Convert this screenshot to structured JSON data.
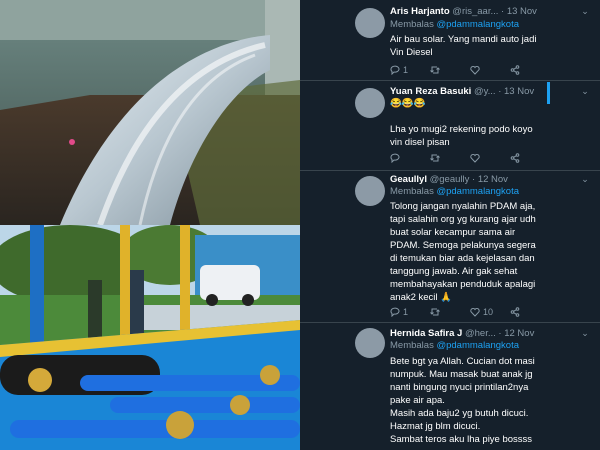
{
  "tweets": [
    {
      "name": "Aris Harjanto",
      "handle": "@ris_aar...",
      "date": "13 Nov",
      "reply_prefix": "Membalas",
      "reply_to": "@pdammalangkota",
      "lines": [
        "Air bau solar. Yang mandi auto jadi",
        "Vin Diesel"
      ],
      "counts": {
        "reply": "1",
        "retweet": "",
        "like": ""
      }
    },
    {
      "name": "Yuan Reza Basuki",
      "handle": "@y...",
      "date": "13 Nov",
      "lines": [
        "😂😂😂",
        "",
        "Lha yo mugi2 rekening podo koyo",
        "vin disel pisan"
      ],
      "counts": {
        "reply": "",
        "retweet": "",
        "like": ""
      }
    },
    {
      "name": "Geaullyl",
      "handle": "@geaully",
      "date": "12 Nov",
      "reply_prefix": "Membalas",
      "reply_to": "@pdammalangkota",
      "lines": [
        "Tolong jangan nyalahin PDAM aja,",
        "tapi salahin org yg kurang ajar udh",
        "buat solar kecampur sama air",
        "PDAM. Semoga pelakunya segera",
        "di temukan biar ada kejelasan dan",
        "tanggung jawab. Air gak sehat",
        "membahayakan penduduk apalagi",
        "anak2 kecil 🙏"
      ],
      "counts": {
        "reply": "1",
        "retweet": "",
        "like": "10"
      }
    },
    {
      "name": "Hernida Safira J",
      "handle": "@her...",
      "date": "12 Nov",
      "reply_prefix": "Membalas",
      "reply_to": "@pdammalangkota",
      "lines": [
        "Bete bgt ya Allah. Cucian dot masi",
        "numpuk. Mau masak buat anak jg",
        "nanti bingung nyuci printilan2nya",
        "pake air apa.",
        "Masih ada baju2 yg butuh dicuci.",
        "Hazmat jg blm dicuci.",
        "Sambat teros aku lha piye bossss"
      ],
      "counts": {
        "reply": "",
        "retweet": "",
        "like": ""
      }
    }
  ],
  "icons": [
    "reply-icon",
    "retweet-icon",
    "like-icon",
    "share-icon",
    "chevron-down-icon"
  ],
  "colors": {
    "background": "#15202b",
    "accent": "#1da1f2",
    "muted": "#8899a6",
    "divider": "#38444d"
  }
}
